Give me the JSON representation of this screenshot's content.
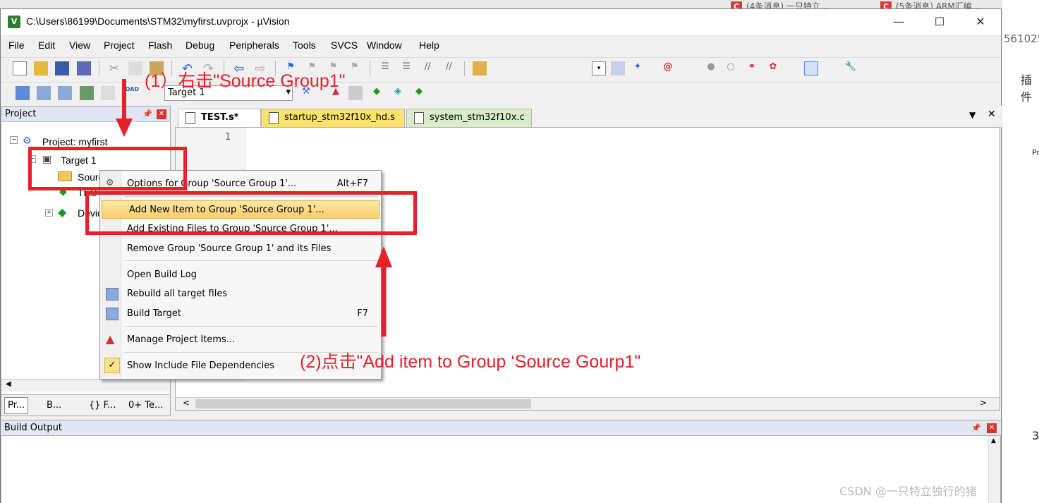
{
  "window": {
    "title": "C:\\Users\\86199\\Documents\\STM32\\myfirst.uvprojx - µVision",
    "controls": {
      "minimize": "—",
      "maximize": "☐",
      "close": "✕"
    }
  },
  "background": {
    "tab1": "(4条消息) 一只特立…",
    "tab2": "(5条消息) ARM汇编…",
    "right_text1": "561025",
    "right_text2": "插件",
    "right_text3": "Pr",
    "right_text4": "3"
  },
  "menubar": [
    "File",
    "Edit",
    "View",
    "Project",
    "Flash",
    "Debug",
    "Peripherals",
    "Tools",
    "SVCS",
    "Window",
    "Help"
  ],
  "toolbar2": {
    "target_select": "Target 1"
  },
  "project_pane": {
    "title": "Project",
    "tree": {
      "root": "Project: myfirst",
      "target": "Target 1",
      "group": "Source Group 1",
      "file": "TEST.s",
      "device": "Device"
    },
    "bottom_tabs": [
      "Pr...",
      "B...",
      "{} F...",
      "0+ Te..."
    ]
  },
  "editor": {
    "tabs": [
      {
        "label": "TEST.s*",
        "active": true
      },
      {
        "label": "startup_stm32f10x_hd.s",
        "active": false
      },
      {
        "label": "system_stm32f10x.c",
        "active": false
      }
    ],
    "line_numbers": [
      "1"
    ]
  },
  "build_output": {
    "title": "Build Output"
  },
  "context_menu": {
    "items": [
      {
        "label": "Options for Group 'Source Group 1'...",
        "shortcut": "Alt+F7"
      },
      {
        "label": "Add New  Item to Group 'Source Group 1'...",
        "shortcut": ""
      },
      {
        "label": "Add Existing Files to Group 'Source Group 1'...",
        "shortcut": ""
      },
      {
        "label": "Remove Group 'Source Group 1' and its Files",
        "shortcut": ""
      },
      {
        "label": "Open Build Log",
        "shortcut": ""
      },
      {
        "label": "Rebuild all target files",
        "shortcut": ""
      },
      {
        "label": "Build Target",
        "shortcut": "F7"
      },
      {
        "label": "Manage Project Items...",
        "shortcut": ""
      },
      {
        "label": "Show Include File Dependencies",
        "shortcut": ""
      }
    ]
  },
  "annotations": {
    "step1": "(1）右击\"Source Group1\"",
    "step2": "(2)点击\"Add item to Group ‘Source Gourp1\""
  },
  "watermark": "CSDN @一只特立独行的猪",
  "colors": {
    "annotation_red": "#e8202a",
    "highlight": "#f8cf6b",
    "tab_active": "#ffe26b"
  }
}
